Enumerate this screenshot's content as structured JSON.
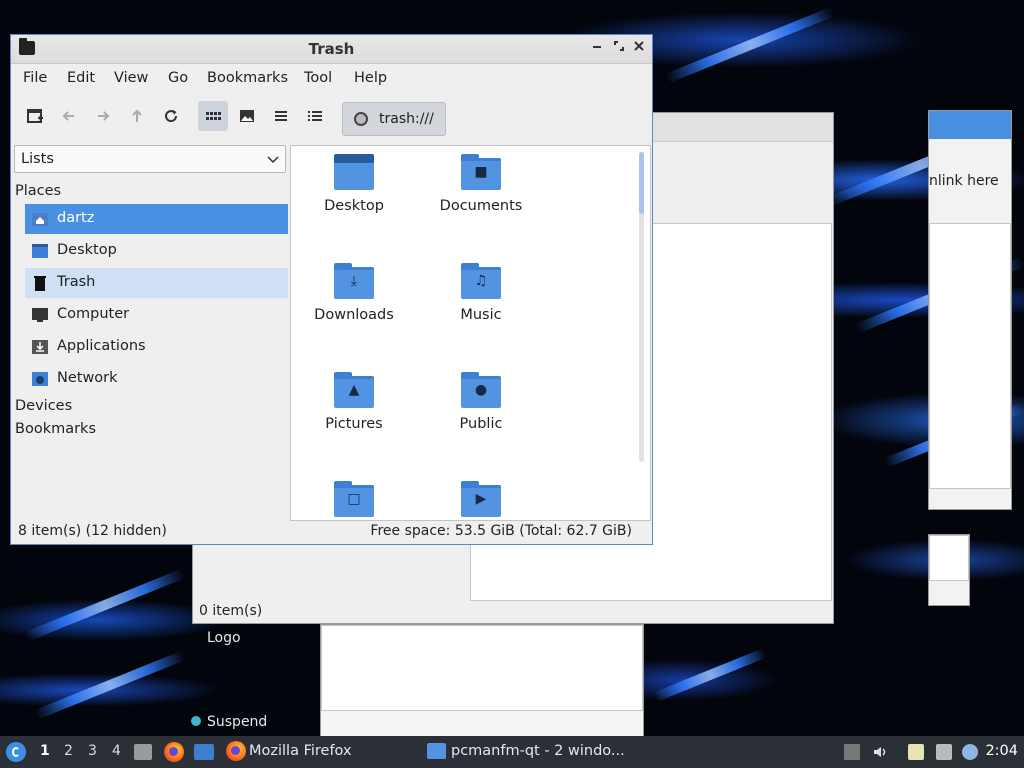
{
  "window": {
    "title": "Trash"
  },
  "menu": [
    "File",
    "Edit",
    "View",
    "Go",
    "Bookmarks",
    "Tool",
    "Help"
  ],
  "toolbar": {
    "address": "trash:///"
  },
  "side_panel": {
    "mode": "Lists",
    "sections": {
      "places": "Places",
      "devices": "Devices",
      "bookmarks": "Bookmarks"
    },
    "places": [
      {
        "label": "dartz",
        "icon": "home-icon",
        "state": "selected"
      },
      {
        "label": "Desktop",
        "icon": "desktop-icon",
        "state": "normal"
      },
      {
        "label": "Trash",
        "icon": "trash-icon",
        "state": "hover"
      },
      {
        "label": "Computer",
        "icon": "computer-icon",
        "state": "normal"
      },
      {
        "label": "Applications",
        "icon": "applications-icon",
        "state": "normal"
      },
      {
        "label": "Network",
        "icon": "network-icon",
        "state": "normal"
      }
    ]
  },
  "files": [
    {
      "label": "Desktop",
      "icon": "desktop-folder-icon"
    },
    {
      "label": "Documents",
      "icon": "documents-folder-icon"
    },
    {
      "label": "Downloads",
      "icon": "downloads-folder-icon"
    },
    {
      "label": "Music",
      "icon": "music-folder-icon"
    },
    {
      "label": "Pictures",
      "icon": "pictures-folder-icon"
    },
    {
      "label": "Public",
      "icon": "public-folder-icon"
    },
    {
      "label": "",
      "icon": "templates-folder-icon"
    },
    {
      "label": "",
      "icon": "videos-folder-icon"
    }
  ],
  "status": {
    "items": "8 item(s) (12 hidden)",
    "free_space": "Free space: 53.5 GiB (Total: 62.7 GiB)"
  },
  "background_windows": {
    "status": "0 item(s)",
    "link_text": "nlink here",
    "logout": "Logo",
    "suspend": "Suspend"
  },
  "taskbar": {
    "workspaces": [
      "1",
      "2",
      "3",
      "4"
    ],
    "active_workspace": "1",
    "tasks": [
      {
        "label": "Mozilla Firefox",
        "icon": "firefox-icon"
      },
      {
        "label": "pcmanfm-qt - 2 windo...",
        "icon": "folder-icon"
      }
    ],
    "clock": "2:04"
  },
  "colors": {
    "accent": "#4a90e2",
    "folder": "#5294e2",
    "taskbar": "#2b2f36"
  }
}
